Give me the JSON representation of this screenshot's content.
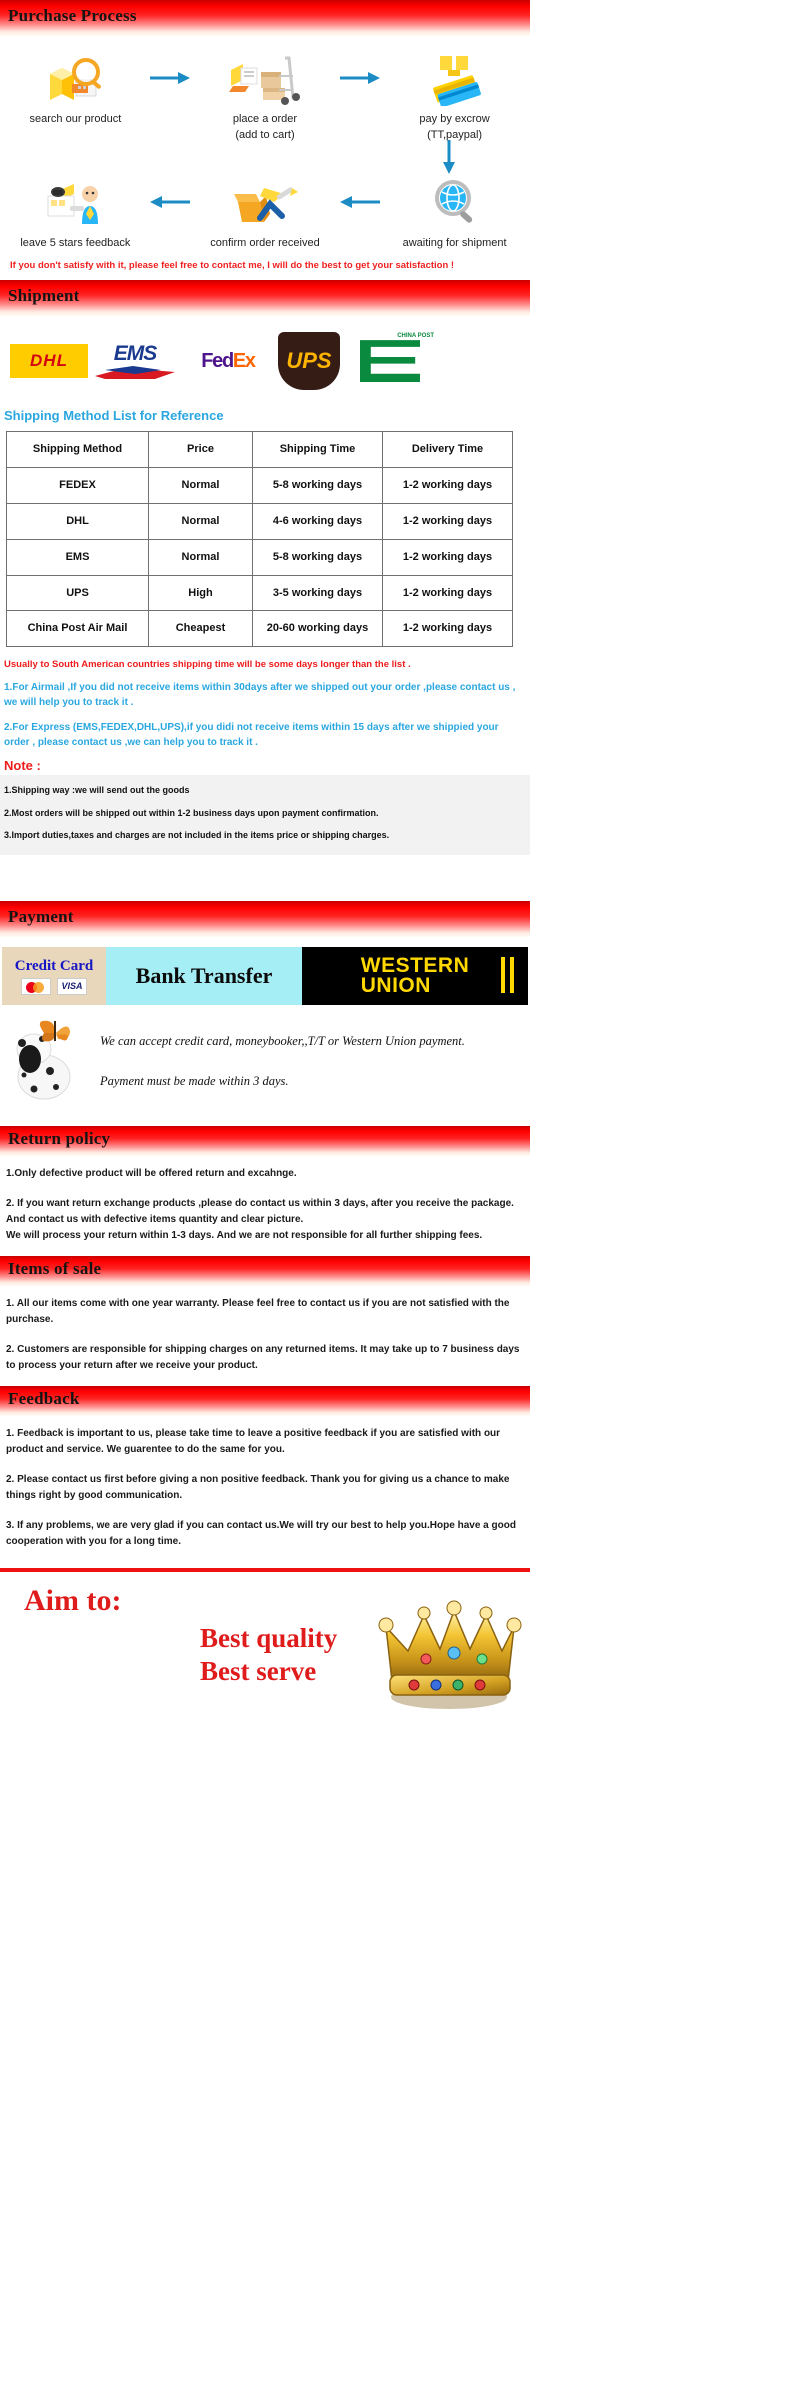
{
  "sections": {
    "purchase": {
      "title": "Purchase Process"
    },
    "shipment": {
      "title": "Shipment"
    },
    "payment": {
      "title": "Payment"
    },
    "return_policy": {
      "title": "Return policy"
    },
    "items_of_sale": {
      "title": "Items of sale"
    },
    "feedback": {
      "title": "Feedback"
    }
  },
  "purchase_process": {
    "row1": [
      {
        "label": "search our product",
        "icon": "magnifier-building-icon"
      },
      {
        "label": "place a order\n(add to cart)",
        "label_line1": "place a order",
        "label_line2": "(add to cart)",
        "icon": "cart-boxes-icon"
      },
      {
        "label": "pay by excrow",
        "label_line1": "pay by excrow",
        "label_line2": "(TT,paypal)",
        "icon": "credit-cards-icon"
      }
    ],
    "row2": [
      {
        "label": "leave 5 stars feedback",
        "icon": "feedback-person-icon"
      },
      {
        "label": "confirm order received",
        "icon": "open-box-check-icon"
      },
      {
        "label": "awaiting for shipment",
        "icon": "magnifier-globe-icon"
      }
    ],
    "note": "If  you don't satisfy with it, please feel free to contact me, I will do the best to get your satisfaction !"
  },
  "carriers": [
    {
      "name": "DHL",
      "icon": "dhl-logo"
    },
    {
      "name": "EMS",
      "icon": "ems-logo"
    },
    {
      "name": "FedEx",
      "icon": "fedex-logo"
    },
    {
      "name": "UPS",
      "icon": "ups-logo"
    },
    {
      "name": "CHINA POST",
      "icon": "china-post-logo"
    }
  ],
  "shipping": {
    "heading": "Shipping Method List for Reference",
    "columns": [
      "Shipping Method",
      "Price",
      "Shipping Time",
      "Delivery Time"
    ],
    "rows": [
      [
        "FEDEX",
        "Normal",
        "5-8 working days",
        "1-2 working days"
      ],
      [
        "DHL",
        "Normal",
        "4-6 working days",
        "1-2 working days"
      ],
      [
        "EMS",
        "Normal",
        "5-8 working days",
        "1-2 working days"
      ],
      [
        "UPS",
        "High",
        "3-5 working days",
        "1-2 working days"
      ],
      [
        "China Post Air Mail",
        "Cheapest",
        "20-60 working days",
        "1-2 working days"
      ]
    ],
    "south_america_note": "Usually to South American countries shipping time will be some days longer than the list .",
    "airmail_para": "1.For Airmail ,If you did not receive items within 30days after we shipped out your order ,please contact us , we will help you to track it .",
    "express_para": "2.For Express (EMS,FEDEX,DHL,UPS),if you didi not receive items within 15 days after we shippied your order , please contact us ,we can help you to track it .",
    "note_title": "Note :",
    "notes": [
      "1.Shipping way :we will send out the goods",
      "2.Most orders will be shipped out within 1-2 business days upon payment confirmation.",
      "3.Import duties,taxes and charges are not included in the items price or shipping charges."
    ]
  },
  "payment": {
    "logos": {
      "credit_card": "Credit Card",
      "bank_transfer": "Bank Transfer",
      "western_union_line1": "WESTERN",
      "western_union_line2": "UNION"
    },
    "lines": [
      "We can accept credit card, moneybooker,,T/T or Western Union payment.",
      "Payment must be made within 3 days."
    ]
  },
  "return_policy": {
    "paragraphs": [
      "1.Only defective product will be offered return and excahnge.",
      "2. If you want return exchange products ,please do contact us within 3 days, after you receive the package. And contact us with defective items quantity and clear picture.\nWe will process your return within 1-3 days. And we are not responsible for all further shipping fees."
    ]
  },
  "items_of_sale": {
    "paragraphs": [
      "1. All our items come with one year warranty. Please feel free to contact us if you are not satisfied with the purchase.",
      "2. Customers are responsible for shipping charges on any returned items. It may take up to 7 business days to process your return after we receive your product."
    ]
  },
  "feedback": {
    "paragraphs": [
      "1. Feedback is important to us, please take time to leave a positive feedback if you are satisfied with our product and service. We guarentee to do the same for you.",
      "2. Please contact us first before giving a non positive feedback. Thank you for giving us a chance to make things right by good communication.",
      "3. If any problems, we are very glad if you can contact us.We will try our best to help you.Hope have a good cooperation with you for a long time."
    ]
  },
  "aim": {
    "title": "Aim to:",
    "line1": "Best quality",
    "line2": "Best serve",
    "crown_icon": "gold-crown-icon"
  },
  "colors": {
    "banner_red": "#ff0000",
    "accent_blue": "#2aa7e0",
    "note_red": "#ee1c1c",
    "arrow_blue": "#1b8cc4"
  }
}
